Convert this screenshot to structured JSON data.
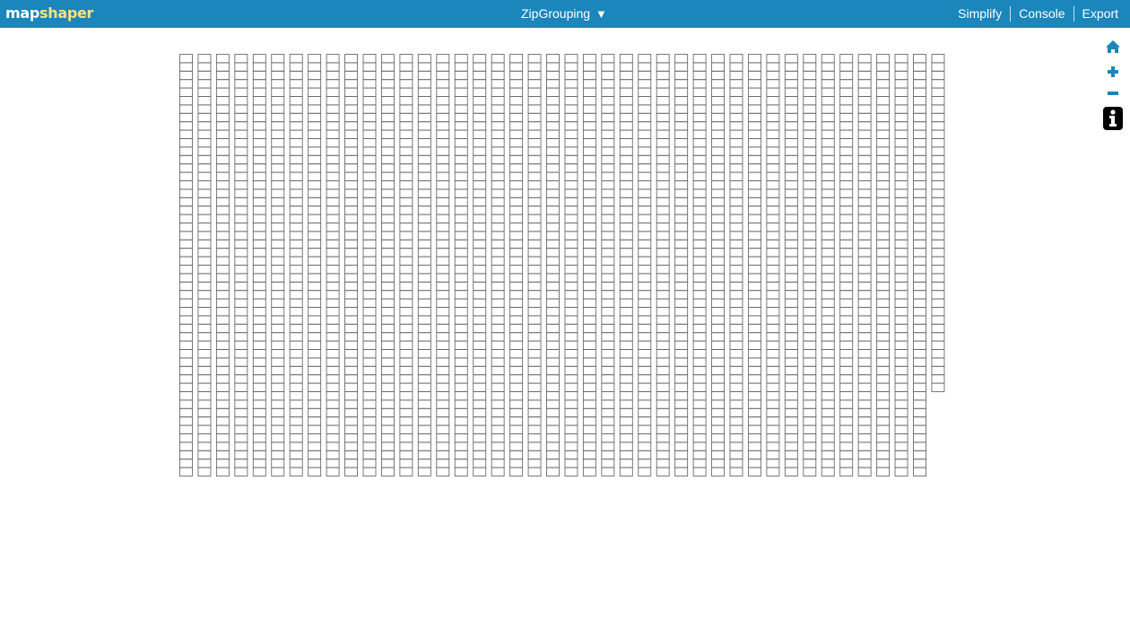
{
  "header": {
    "logo": {
      "part1": "map",
      "part2": "shaper"
    },
    "layer_menu": {
      "label": "ZipGrouping",
      "icon": "dropdown-triangle-icon"
    },
    "nav": [
      {
        "name": "simplify",
        "label": "Simplify"
      },
      {
        "name": "console",
        "label": "Console"
      },
      {
        "name": "export",
        "label": "Export"
      }
    ]
  },
  "map_tools": [
    {
      "name": "home",
      "icon": "home-icon"
    },
    {
      "name": "zoom-in",
      "icon": "plus-icon"
    },
    {
      "name": "zoom-out",
      "icon": "minus-icon"
    },
    {
      "name": "info",
      "icon": "info-icon"
    }
  ],
  "map": {
    "grid": {
      "columns": 42,
      "rows_full": 50,
      "rows_last_column": 40,
      "stroke_color": "#6b6b6b"
    }
  },
  "colors": {
    "header_bg": "#1a86bc",
    "logo_accent": "#ffe27a",
    "tool_icon": "#1a86bc"
  }
}
